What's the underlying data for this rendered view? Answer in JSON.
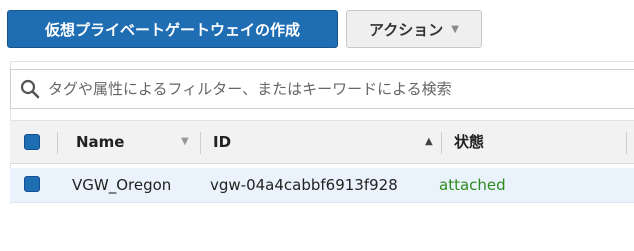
{
  "toolbar": {
    "create_label": "仮想プライベートゲートウェイの作成",
    "actions_label": "アクション"
  },
  "search": {
    "placeholder": "タグや属性によるフィルター、またはキーワードによる検索"
  },
  "table": {
    "columns": [
      "Name",
      "ID",
      "状態"
    ],
    "sorted_column": "ID",
    "sort_direction": "ascending",
    "rows": [
      {
        "selected": true,
        "name": "VGW_Oregon",
        "id": "vgw-04a4cabbf6913f928",
        "state": "attached"
      }
    ]
  },
  "colors": {
    "primary": "#1f6db3",
    "status_attached": "#2e8b1f",
    "selected_row": "#eaf3fb"
  },
  "icons": {
    "search": "search-icon",
    "actions_caret": "chevron-down-icon"
  }
}
